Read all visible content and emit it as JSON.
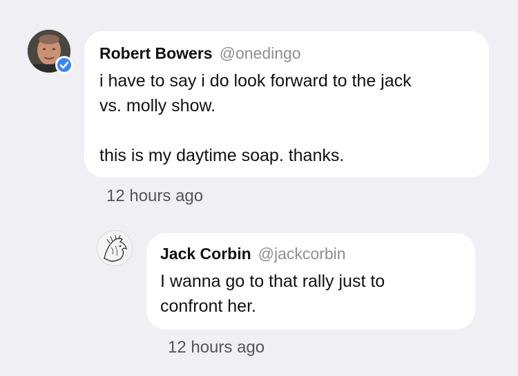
{
  "comments": [
    {
      "author": "Robert Bowers",
      "handle": "@onedingo",
      "verified": true,
      "text_line1": "i have to say i do look forward to the jack",
      "text_line2": "vs. molly show.",
      "text_line3": "this is my daytime soap. thanks.",
      "timestamp": "12 hours ago"
    },
    {
      "author": "Jack Corbin",
      "handle": "@jackcorbin",
      "verified": false,
      "text_line1": "I wanna go to that rally just to",
      "text_line2": "confront her.",
      "timestamp": "12 hours ago"
    }
  ],
  "colors": {
    "background": "#efeff4",
    "bubble": "#ffffff",
    "verified_badge": "#3b86f0",
    "handle": "#8e8e93"
  },
  "icons": {
    "verified_badge": "checkmark-badge-icon"
  }
}
